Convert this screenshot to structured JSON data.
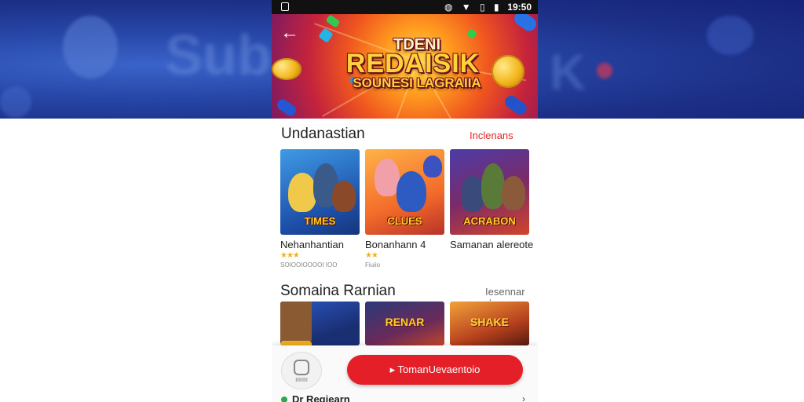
{
  "status_bar": {
    "time": "19:50",
    "icons": [
      "vibrate-icon",
      "wifi-icon",
      "signal-icon",
      "battery-icon"
    ]
  },
  "banner": {
    "title_line1": "TDENI",
    "title_line2": "REDAISIK",
    "title_line3": "SOUNESI LAGRAIIA"
  },
  "section1": {
    "title": "Undanastian",
    "link": "Inclenans",
    "cards": [
      {
        "name": "Nehanhantian",
        "logo": "TIMES",
        "meta": "SOIOOIOOOOI IOO"
      },
      {
        "name": "Bonanhann",
        "suffix": "4",
        "logo": "CLUES",
        "meta": "Fiuiio"
      },
      {
        "name": "Samanan alereote",
        "logo": "ACRABON",
        "meta": ""
      }
    ]
  },
  "section2": {
    "title": "Somaina Rarnian",
    "link": "Iesennar",
    "cards": [
      {
        "logo": ""
      },
      {
        "logo": "RENAR"
      },
      {
        "logo": "SHAKE"
      }
    ]
  },
  "bottom_bar": {
    "app_icon_label": "IIIIIIII",
    "cta_label": "TomanUevaentoio",
    "peek_text": "Dr Regiearn"
  },
  "colors": {
    "accent": "#e41f27",
    "link": "#e02828",
    "background_band": "#1c2f86"
  }
}
